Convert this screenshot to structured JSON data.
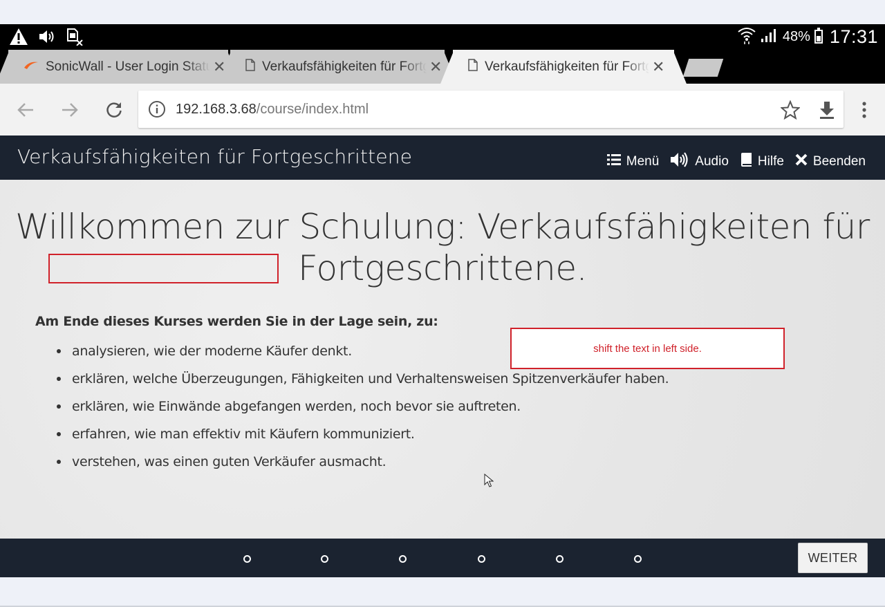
{
  "status_bar": {
    "battery_percent": "48%",
    "time": "17:31",
    "icons": [
      "warning-icon",
      "volume-icon",
      "no-sim-icon",
      "wifi-icon",
      "signal-icon",
      "battery-icon"
    ]
  },
  "tabs": [
    {
      "title": "SonicWall - User Login Status",
      "icon": "sonicwall-icon",
      "active": false
    },
    {
      "title": "Verkaufsfähigkeiten für Fortgeschrittene",
      "icon": "page-icon",
      "active": false
    },
    {
      "title": "Verkaufsfähigkeiten für Fortgeschrittene",
      "icon": "page-icon",
      "active": true
    }
  ],
  "address_bar": {
    "host": "192.168.3.68",
    "path": "/course/index.html"
  },
  "course": {
    "title": "Verkaufsfähigkeiten für Fortgeschrittene",
    "nav": {
      "menu": "Menü",
      "audio": "Audio",
      "help": "Hilfe",
      "exit": "Beenden"
    },
    "welcome_line1": "Willkommen zur Schulung: Verkaufsfähigkeiten für",
    "welcome_line2": "Fortgeschrittene.",
    "objectives_heading": "Am Ende dieses Kurses werden Sie in der Lage sein, zu:",
    "objectives": [
      "analysieren, wie der moderne Käufer denkt.",
      "erklären, welche Überzeugungen, Fähigkeiten und Verhaltensweisen Spitzenverkäufer haben.",
      "erklären, wie Einwände abgefangen werden, noch bevor sie auftreten.",
      "erfahren, wie man effektiv mit Käufern kommuniziert.",
      "verstehen, was einen guten Verkäufer ausmacht."
    ],
    "annotation": "shift the text in left side.",
    "next_button": "WEITER",
    "page_dots": 6
  },
  "colors": {
    "header_bg": "#1b2330",
    "annotation_red": "#d0212a",
    "sonicwall_orange": "#f26522"
  }
}
